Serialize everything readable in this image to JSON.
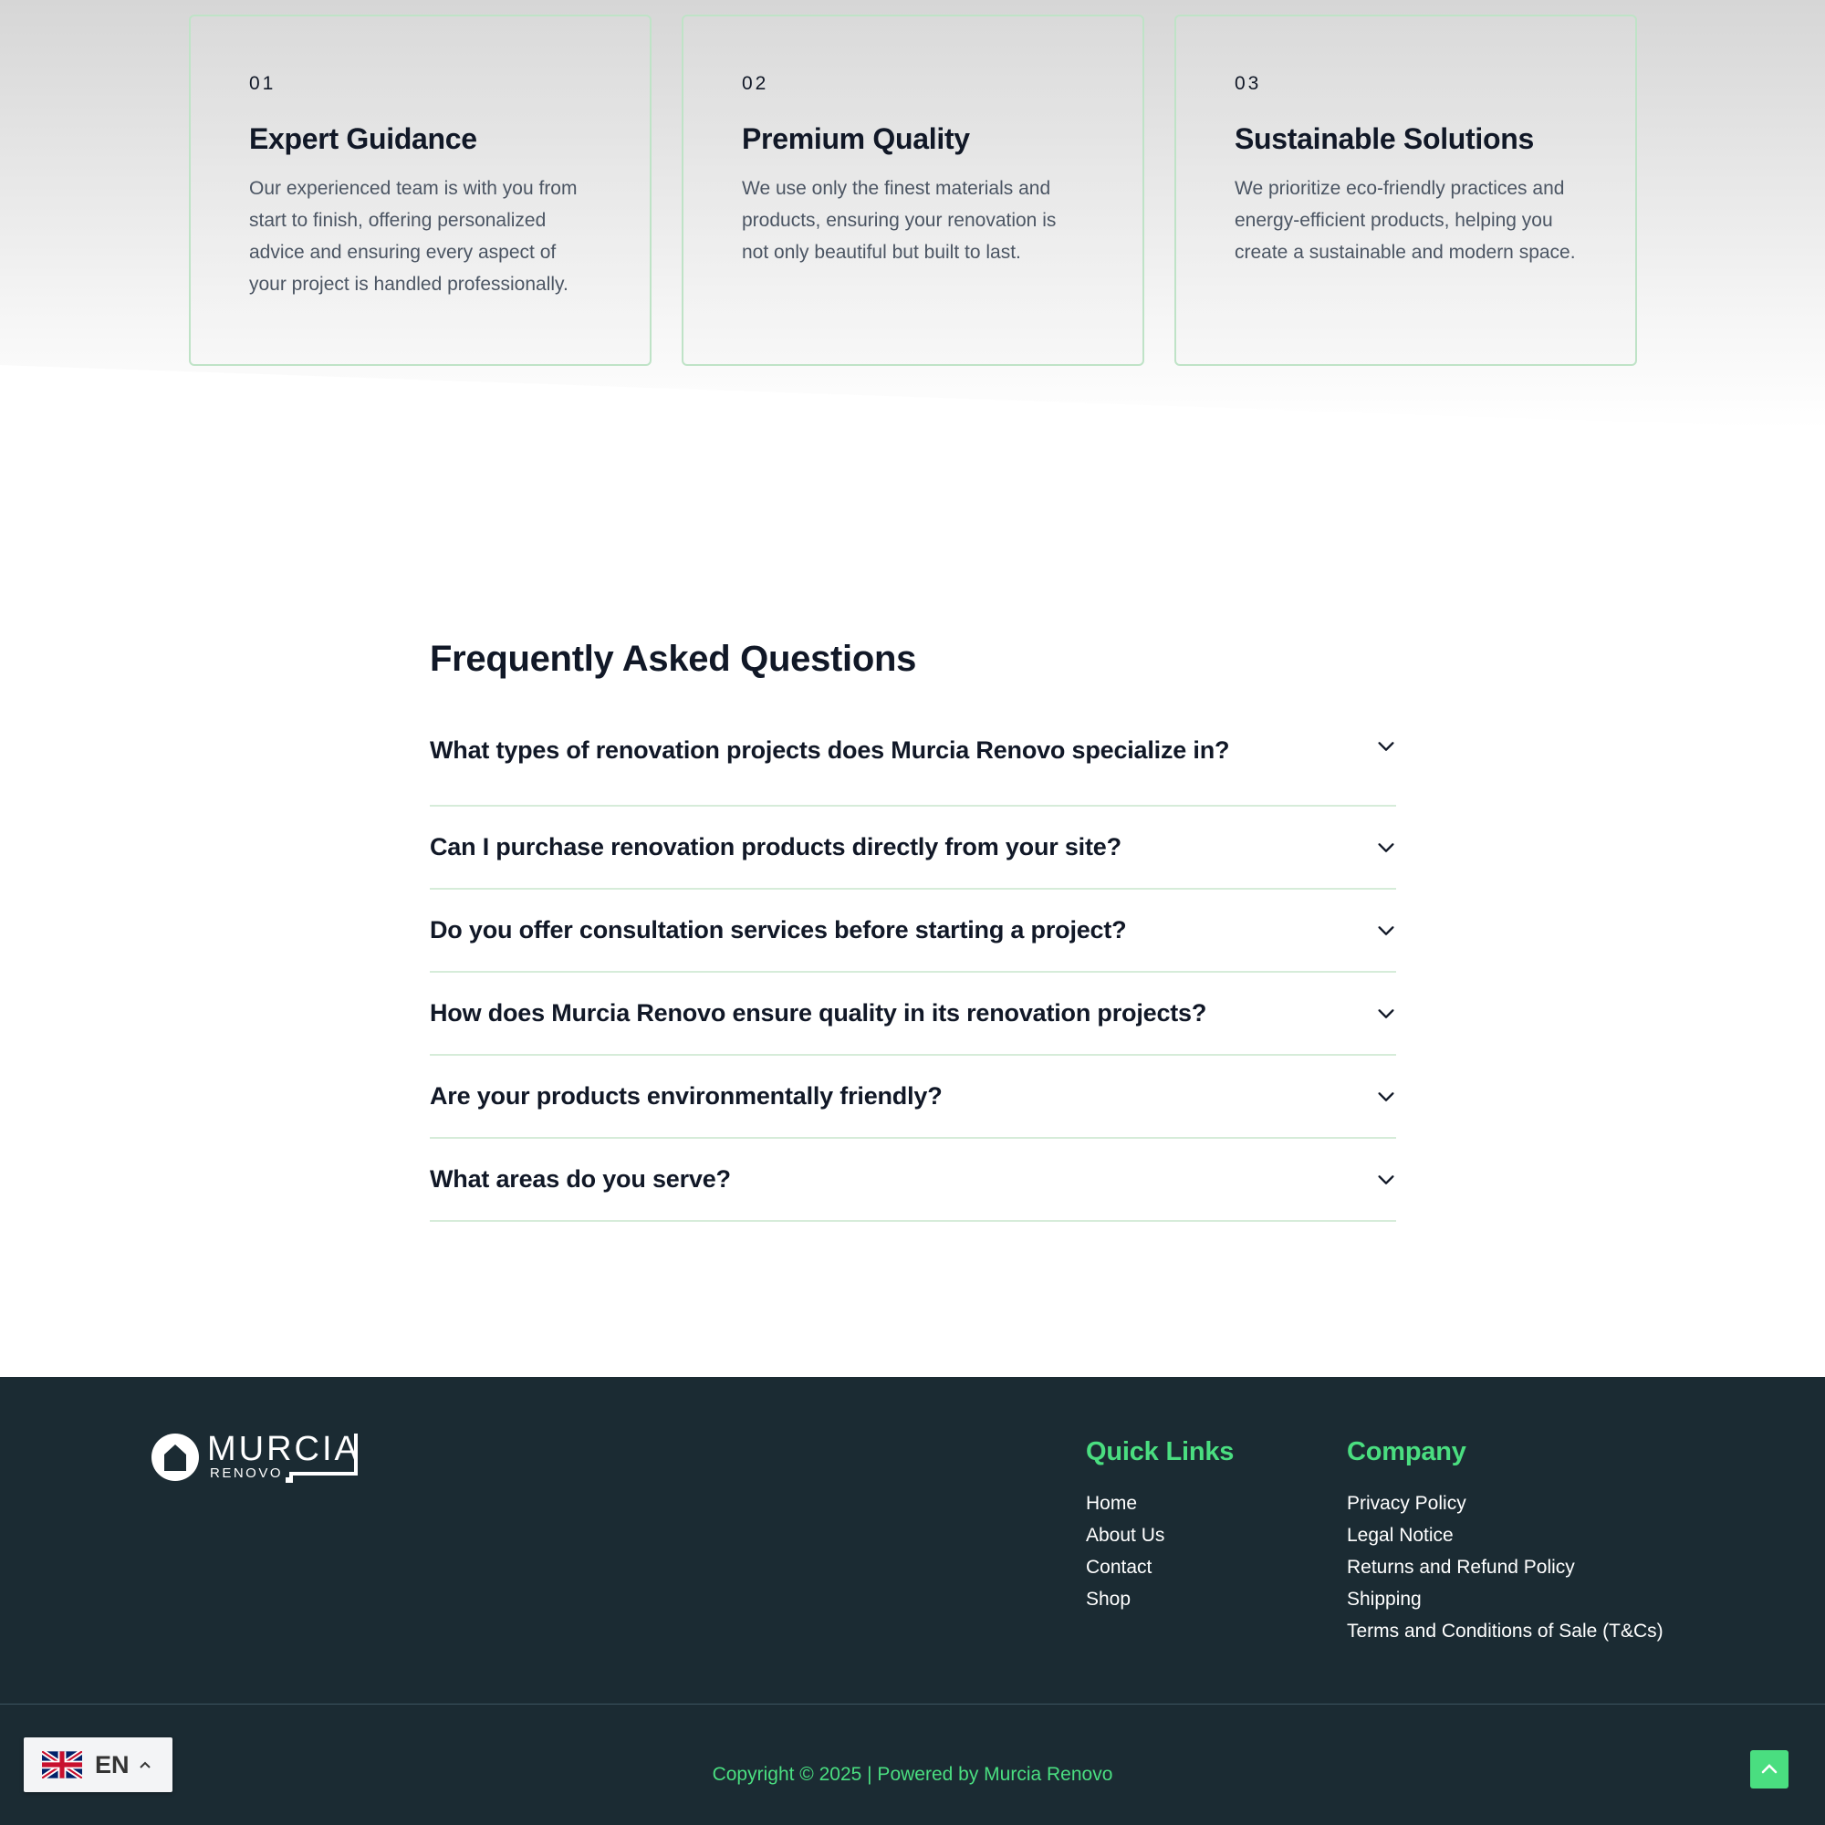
{
  "features": {
    "cards": [
      {
        "number": "01",
        "title": "Expert Guidance",
        "text": "Our experienced team is with you from start to finish, offering personalized advice and ensuring every aspect of your project is handled professionally."
      },
      {
        "number": "02",
        "title": "Premium Quality",
        "text": "We use only the finest materials and products, ensuring your renovation is not only beautiful but built to last."
      },
      {
        "number": "03",
        "title": "Sustainable Solutions",
        "text": "We prioritize eco-friendly practices and energy-efficient products, helping you create a sustainable and modern space."
      }
    ]
  },
  "faq": {
    "title": "Frequently Asked Questions",
    "items": [
      {
        "question": "What types of renovation projects does Murcia Renovo specialize in?"
      },
      {
        "question": "Can I purchase renovation products directly from your site?"
      },
      {
        "question": "Do you offer consultation services before starting a project?"
      },
      {
        "question": "How does Murcia Renovo ensure quality in its renovation projects?"
      },
      {
        "question": "Are your products environmentally friendly?"
      },
      {
        "question": "What areas do you serve?"
      }
    ]
  },
  "footer": {
    "logo": {
      "word1": "MURCIA",
      "word2": "RENOVO"
    },
    "quick_links": {
      "title": "Quick Links",
      "items": [
        "Home",
        "About Us",
        "Contact",
        "Shop"
      ]
    },
    "company": {
      "title": "Company",
      "items": [
        "Privacy Policy",
        "Legal Notice",
        "Returns and Refund Policy",
        "Shipping",
        "Terms and Conditions of Sale (T&Cs)"
      ]
    },
    "copyright": "Copyright © 2025 | Powered by Murcia Renovo"
  },
  "language_switcher": {
    "code": "EN",
    "flag": "uk-flag-icon"
  },
  "colors": {
    "accent": "#4ade80",
    "footer_bg": "#1b2b33",
    "card_border": "#bfe3c7",
    "text_dark": "#111827"
  }
}
